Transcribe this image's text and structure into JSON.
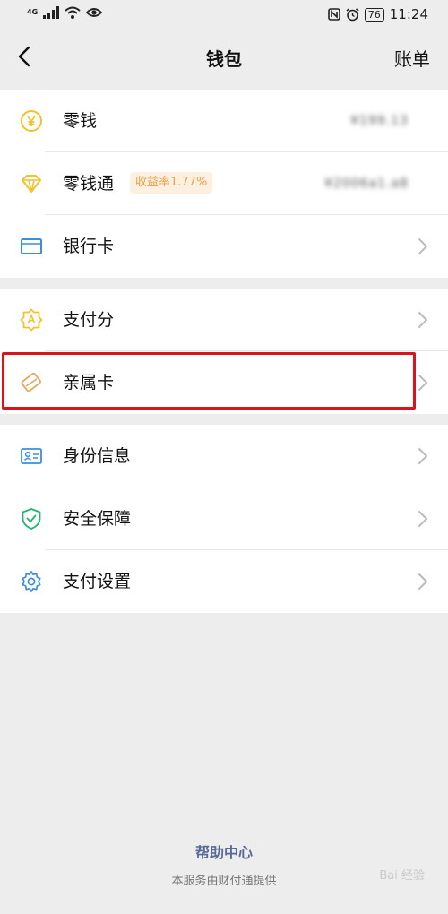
{
  "status_bar": {
    "network": "4G",
    "time": "11:24",
    "battery": "76"
  },
  "header": {
    "title": "钱包",
    "right_action": "账单"
  },
  "group1": [
    {
      "label": "零钱",
      "value": "¥199.13"
    },
    {
      "label": "零钱通",
      "badge": "收益率1.77%",
      "value": "¥2006a1.a8"
    },
    {
      "label": "银行卡"
    }
  ],
  "group2": [
    {
      "label": "支付分"
    },
    {
      "label": "亲属卡"
    }
  ],
  "group3": [
    {
      "label": "身份信息"
    },
    {
      "label": "安全保障"
    },
    {
      "label": "支付设置"
    }
  ],
  "footer": {
    "help": "帮助中心",
    "provider": "本服务由财付通提供"
  },
  "watermark": "Bai 经验",
  "colors": {
    "accent_yellow": "#f2c12e",
    "link_blue": "#576b95",
    "highlight_red": "#d9141b",
    "icon_blue": "#3b8fd9",
    "icon_green": "#22b573"
  }
}
